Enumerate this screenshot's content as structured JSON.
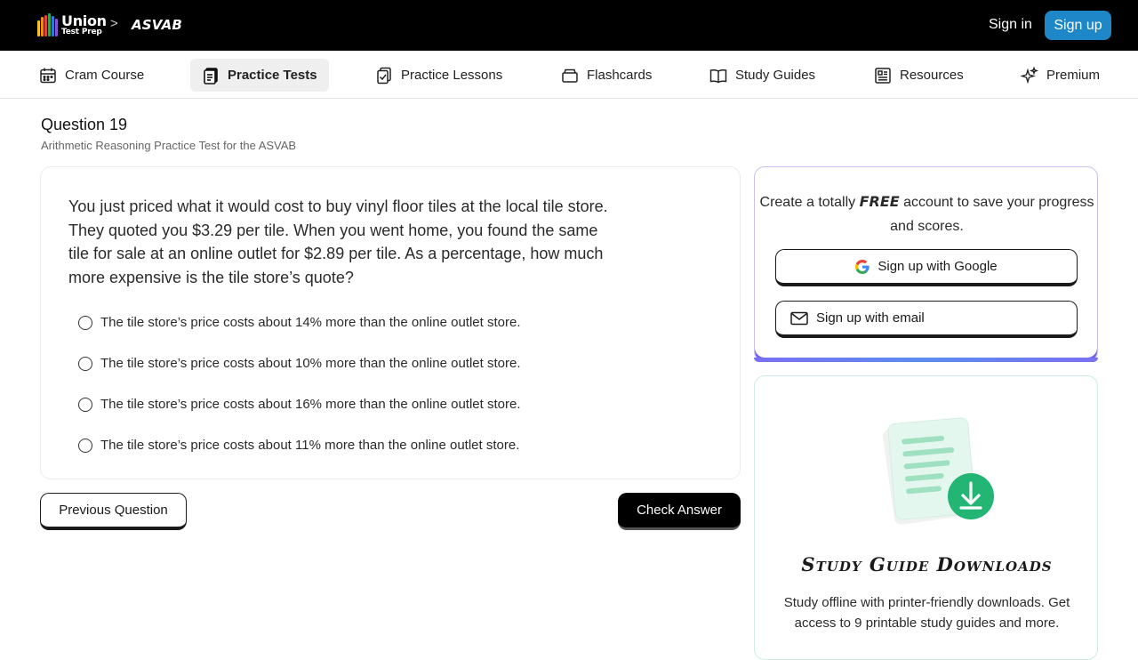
{
  "header": {
    "logo_line1": "Union",
    "logo_line2": "Test Prep",
    "breadcrumb_separator": ">",
    "breadcrumb": "ASVAB",
    "sign_in": "Sign in",
    "sign_up": "Sign up",
    "sign_up_color": "#1d87c8"
  },
  "nav": {
    "items": [
      {
        "label": "Cram Course",
        "icon": "calendar-icon"
      },
      {
        "label": "Practice Tests",
        "icon": "clipboard-icon",
        "active": true
      },
      {
        "label": "Practice Lessons",
        "icon": "checklist-icon"
      },
      {
        "label": "Flashcards",
        "icon": "flashcards-icon"
      },
      {
        "label": "Study Guides",
        "icon": "book-icon"
      },
      {
        "label": "Resources",
        "icon": "document-icon"
      },
      {
        "label": "Premium",
        "icon": "sparkle-icon"
      }
    ]
  },
  "question": {
    "title": "Question 19",
    "subtitle": "Arithmetic Reasoning Practice Test for the ASVAB",
    "text": "You just priced what it would cost to buy vinyl floor tiles at the local tile store. They quoted you $3.29 per tile. When you went home, you found the same tile for sale at an online outlet for $2.89 per tile. As a percentage, how much more expensive is the tile store’s quote?",
    "options": [
      "The tile store’s price costs about 14% more than the online outlet store.",
      "The tile store’s price costs about 10% more than the online outlet store.",
      "The tile store’s price costs about 16% more than the online outlet store.",
      "The tile store’s price costs about 11% more than the online outlet store."
    ],
    "previous_label": "Previous Question",
    "check_label": "Check Answer"
  },
  "signup_card": {
    "text_before": "Create a totally",
    "free": "FREE",
    "text_after": "account to save your progress and scores.",
    "google_label": "Sign up with Google",
    "email_label": "Sign up with email"
  },
  "downloads_card": {
    "title": "Study Guide Downloads",
    "text": "Study offline with printer-friendly downloads. Get access to 9 printable study guides and more.",
    "accent_color": "#22b573"
  }
}
